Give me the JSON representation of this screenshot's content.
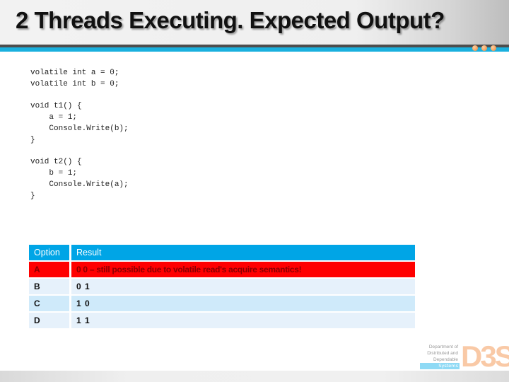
{
  "slide": {
    "title": "2 Threads Executing. Expected Output?",
    "code_lines": [
      "volatile int a = 0;",
      "volatile int b = 0;",
      "",
      "void t1() {",
      "    a = 1;",
      "    Console.Write(b);",
      "}",
      "",
      "void t2() {",
      "    b = 1;",
      "    Console.Write(a);",
      "}"
    ],
    "table": {
      "headers": [
        "Option",
        "Result"
      ],
      "rows": [
        {
          "option": "A",
          "result": "0 0 – still possible due to volatile read's acquire semantics!"
        },
        {
          "option": "B",
          "result": "0 1"
        },
        {
          "option": "C",
          "result": "1 0"
        },
        {
          "option": "D",
          "result": "1 1"
        }
      ]
    },
    "logo": {
      "lines": [
        "Department of",
        "Distributed and",
        "Dependable"
      ],
      "systems": "Systems",
      "mark": "D3S"
    },
    "colors": {
      "accent_blue": "#1ab0de",
      "table_header": "#00a5e6",
      "highlight_red": "#ff0000",
      "dots_orange": "#e8863a"
    }
  }
}
